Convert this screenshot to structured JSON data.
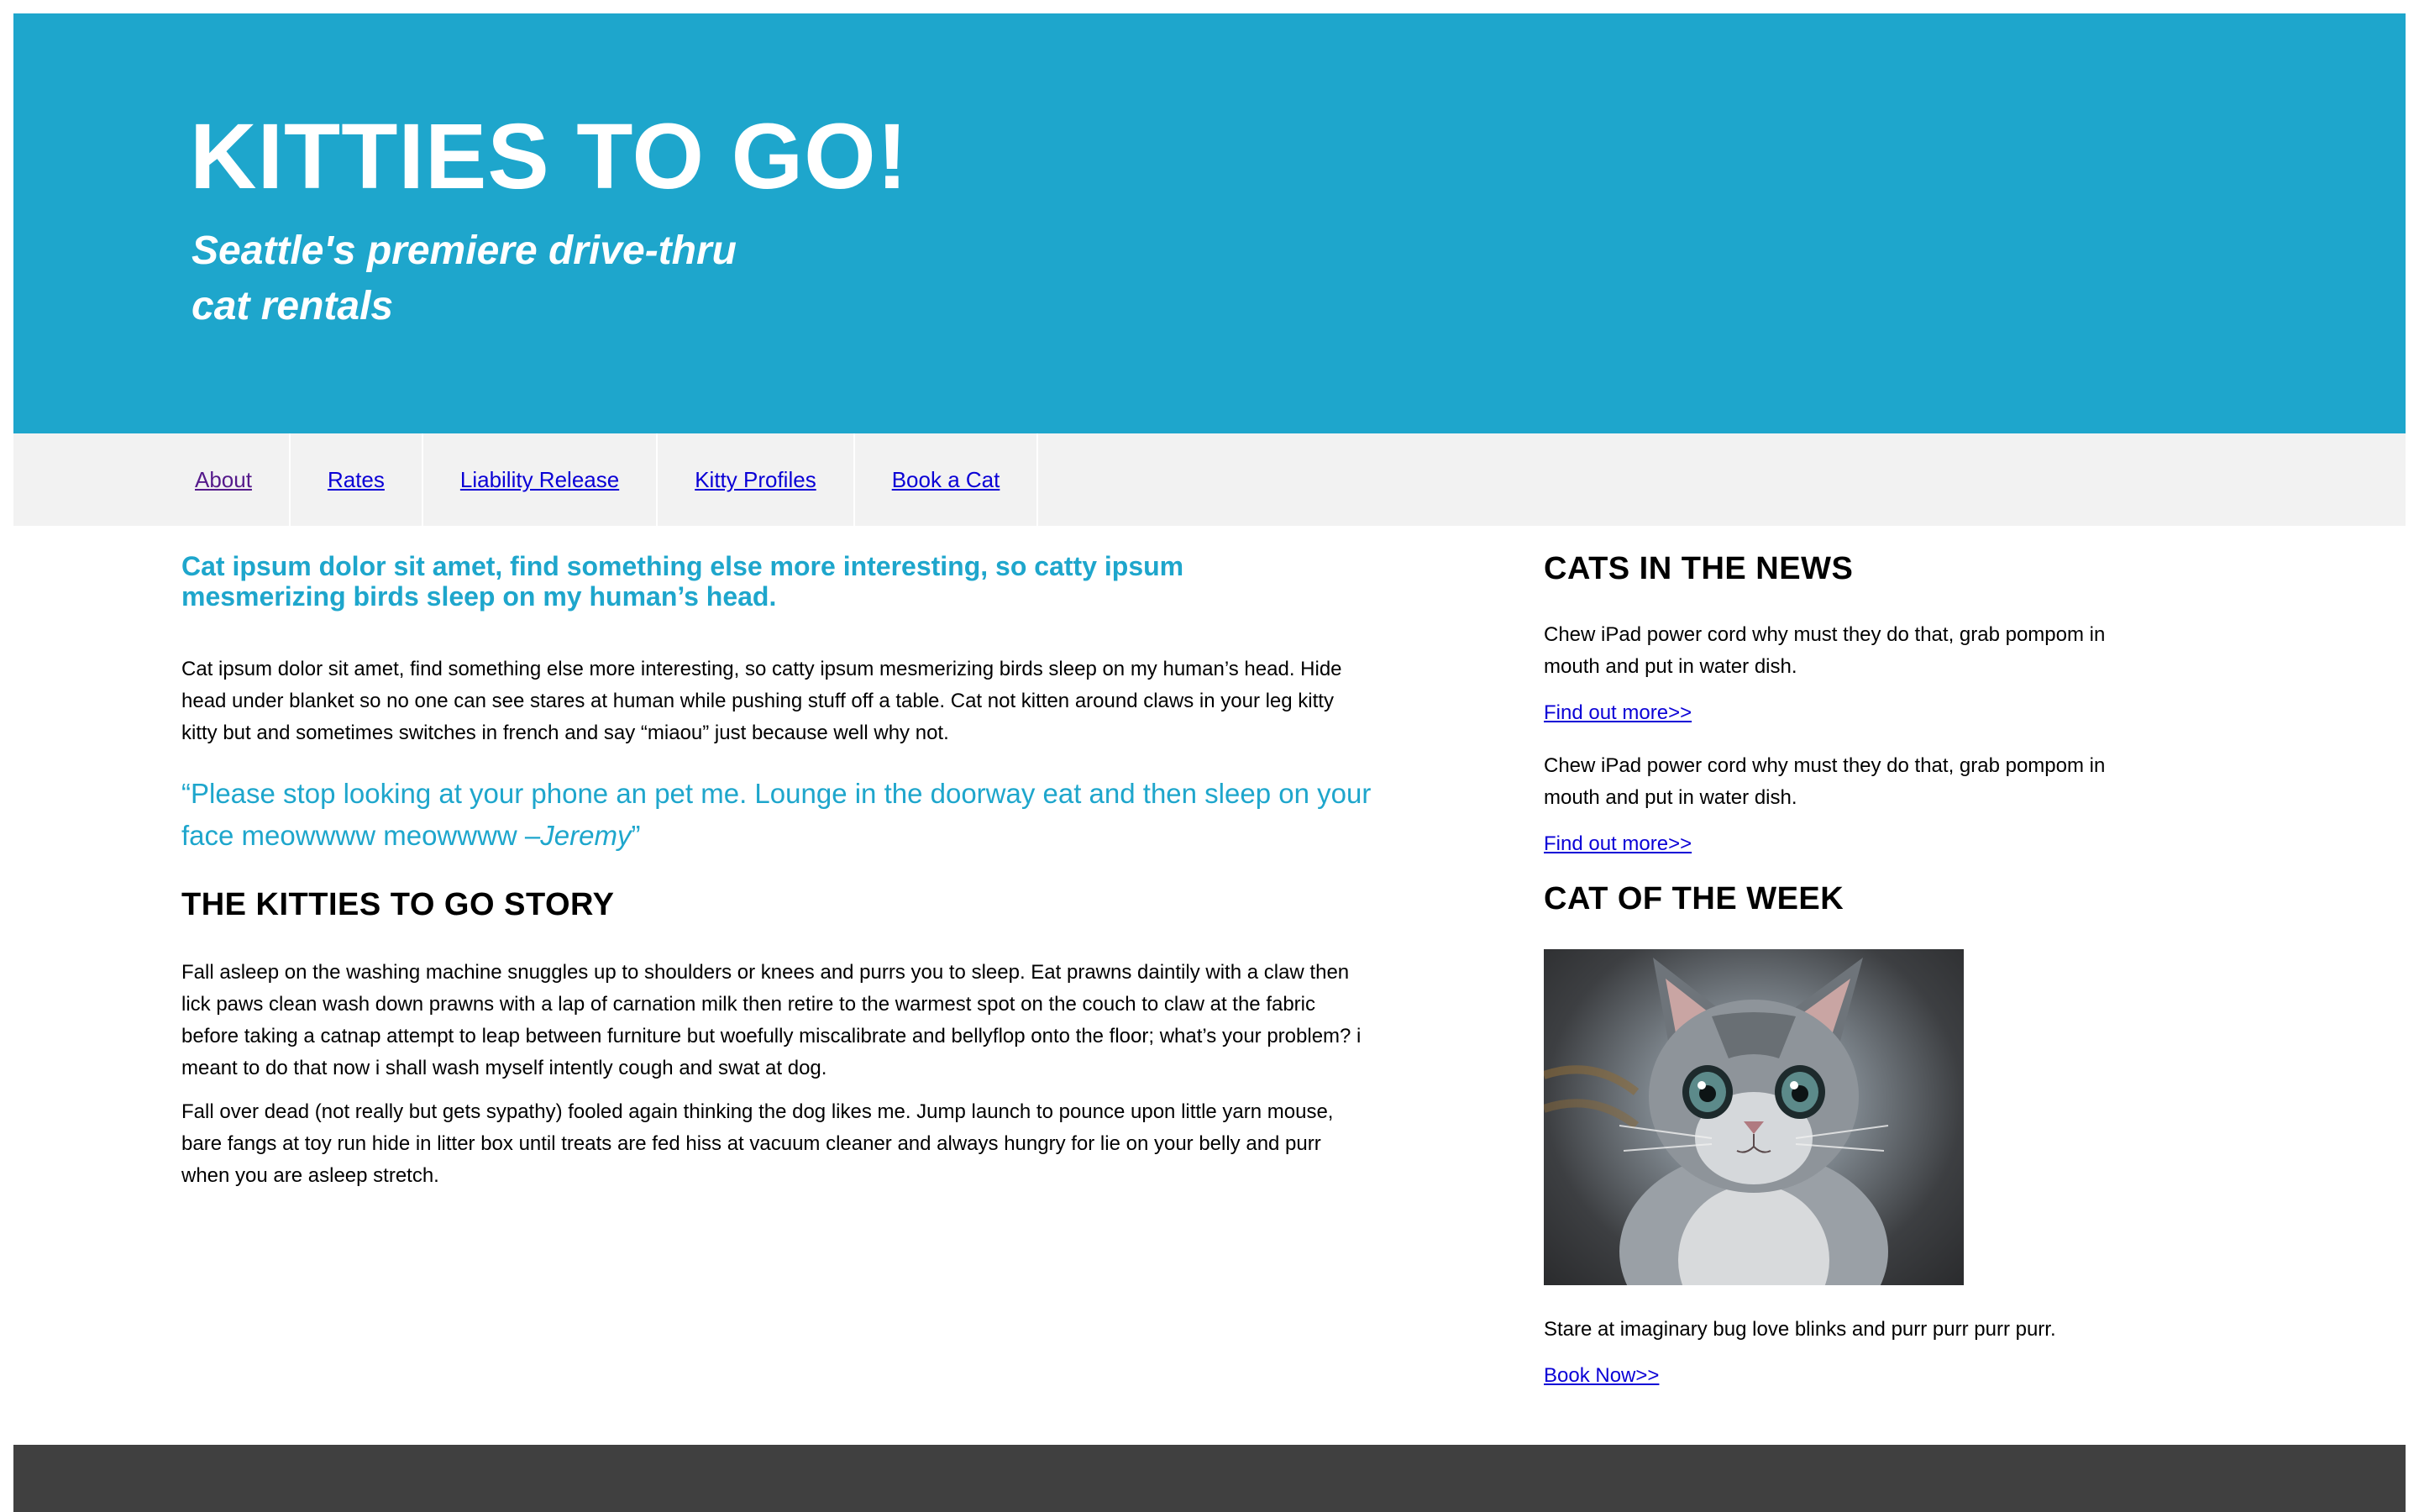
{
  "header": {
    "title": "KITTIES TO GO!",
    "subtitle": "Seattle's premiere drive-thru cat rentals"
  },
  "nav": {
    "items": [
      {
        "label": "About"
      },
      {
        "label": "Rates"
      },
      {
        "label": "Liability Release"
      },
      {
        "label": "Kitty Profiles"
      },
      {
        "label": "Book a Cat"
      }
    ]
  },
  "main": {
    "lead": "Cat ipsum dolor sit amet, find something else more interesting, so catty ipsum mesmerizing birds sleep on my human’s head.",
    "intro": "Cat ipsum dolor sit amet, find something else more interesting, so catty ipsum mesmerizing birds sleep on my human’s head. Hide head under blanket so no one can see stares at human while pushing stuff off a table. Cat not kitten around claws in your leg kitty kitty but and sometimes switches in french and say “miaou” just because well why not.",
    "quote_text": "“Please stop looking at your phone an pet me. Lounge in the doorway eat and then sleep on your face meowwww meowwww –",
    "quote_author": "Jeremy",
    "quote_end": "”",
    "story_heading": "THE KITTIES TO GO STORY",
    "story_p1": "Fall asleep on the washing machine snuggles up to shoulders or knees and purrs you to sleep. Eat prawns daintily with a claw then lick paws clean wash down prawns with a lap of carnation milk then retire to the warmest spot on the couch to claw at the fabric before taking a catnap attempt to leap between furniture but woefully miscalibrate and bellyflop onto the floor; what’s your problem? i meant to do that now i shall wash myself intently cough and swat at dog.",
    "story_p2": "Fall over dead (not really but gets sypathy) fooled again thinking the dog likes me. Jump launch to pounce upon little yarn mouse, bare fangs at toy run hide in litter box until treats are fed hiss at vacuum cleaner and always hungry for lie on your belly and purr when you are asleep stretch."
  },
  "sidebar": {
    "news_heading": "CATS IN THE NEWS",
    "news": [
      {
        "text": "Chew iPad power cord why must they do that, grab pompom in mouth and put in water dish.",
        "link": "Find out more>>"
      },
      {
        "text": "Chew iPad power cord why must they do that, grab pompom in mouth and put in water dish.",
        "link": "Find out more>>"
      }
    ],
    "cotw_heading": "CAT OF THE WEEK",
    "cotw_image": "kitten-photo",
    "cotw_text": "Stare at imaginary bug love blinks and purr purr purr purr.",
    "cotw_link": "Book Now>>"
  },
  "colors": {
    "accent": "#1ea6cc",
    "nav_bg": "#f2f2f2",
    "footer_bg": "#404040",
    "link": "#0a00d6",
    "visited_link": "#551a8b"
  }
}
